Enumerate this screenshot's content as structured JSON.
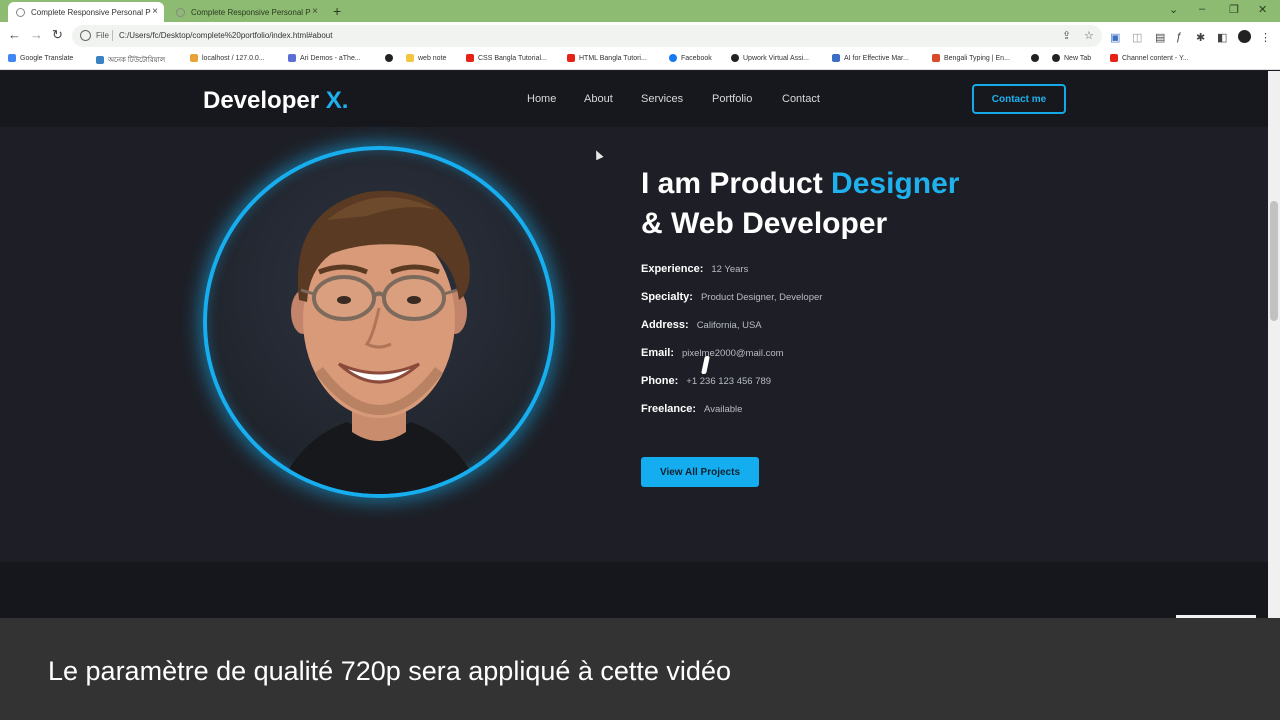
{
  "browser": {
    "tabs": [
      {
        "label": "Complete Responsive Personal P"
      },
      {
        "label": "Complete Responsive Personal P"
      }
    ],
    "address": {
      "scheme_label": "File",
      "url": "C:/Users/fc/Desktop/complete%20portfolio/index.html#about"
    },
    "bookmarks": [
      {
        "label": "Google Translate",
        "color": "#4285f4"
      },
      {
        "label": "অনেক টিউটোরিয়াল",
        "color": "#3b82c4"
      },
      {
        "label": "localhost / 127.0.0...",
        "color": "#e8a33b"
      },
      {
        "label": "Ari Demos - aThe...",
        "color": "#5b6dd6"
      },
      {
        "label": "",
        "color": "#222222"
      },
      {
        "label": "web note",
        "color": "#f4c542"
      },
      {
        "label": "CSS Bangla Tutorial...",
        "color": "#e62117"
      },
      {
        "label": "HTML Bangla Tutori...",
        "color": "#e62117"
      },
      {
        "label": "Facebook",
        "color": "#1877f2"
      },
      {
        "label": "Upwork Virtual Assi...",
        "color": "#222222"
      },
      {
        "label": "AI for Effective Mar...",
        "color": "#3a6fc4"
      },
      {
        "label": "Bengali Typing | En...",
        "color": "#d94a2b"
      },
      {
        "label": "",
        "color": "#222222"
      },
      {
        "label": "New Tab",
        "color": "#222222"
      },
      {
        "label": "Channel content - Y...",
        "color": "#e62117"
      }
    ]
  },
  "site": {
    "logo": {
      "text": "Developer",
      "accent": "X."
    },
    "nav": [
      "Home",
      "About",
      "Services",
      "Portfolio",
      "Contact"
    ],
    "contact_button": "Contact me",
    "headline": {
      "line1_prefix": "I am Product",
      "line1_accent": "Designer",
      "line2": "& Web Developer"
    },
    "info": [
      {
        "label": "Experience:",
        "value": "12 Years"
      },
      {
        "label": "Specialty:",
        "value": "Product Designer, Developer"
      },
      {
        "label": "Address:",
        "value": "California, USA"
      },
      {
        "label": "Email:",
        "value": "pixelme2000@mail.com"
      },
      {
        "label": "Phone:",
        "value": "+1 236 123 456 789"
      },
      {
        "label": "Freelance:",
        "value": "Available"
      }
    ],
    "projects_button": "View All Projects",
    "accent_color": "#1eb1ee"
  },
  "overlay": {
    "message": "Le paramètre de qualité 720p sera appliqué à cette vidéo"
  }
}
